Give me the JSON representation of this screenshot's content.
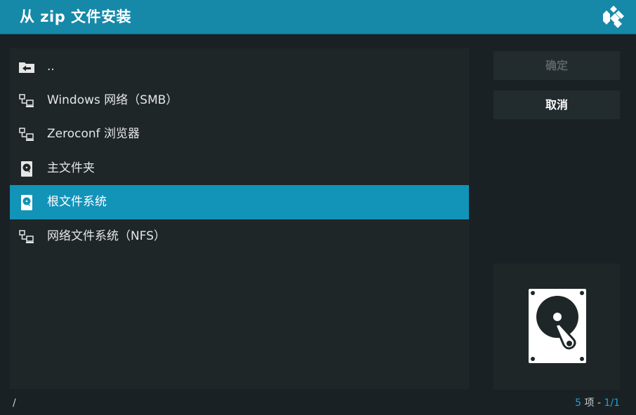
{
  "header": {
    "title": "从 zip 文件安装"
  },
  "list": {
    "items": [
      {
        "label": "..",
        "icon": "folder-back-icon"
      },
      {
        "label": "Windows 网络（SMB）",
        "icon": "network-icon"
      },
      {
        "label": "Zeroconf 浏览器",
        "icon": "network-icon"
      },
      {
        "label": "主文件夹",
        "icon": "harddisk-icon"
      },
      {
        "label": "根文件系统",
        "icon": "harddisk-icon",
        "selected": true
      },
      {
        "label": "网络文件系统（NFS）",
        "icon": "network-icon"
      }
    ]
  },
  "buttons": {
    "ok_label": "确定",
    "cancel_label": "取消"
  },
  "preview": {
    "icon": "harddisk-icon"
  },
  "footer": {
    "path": "/",
    "count_value": "5",
    "count_unit": " 项 - ",
    "page": "1/1"
  },
  "colors": {
    "header_bg": "#1689a8",
    "selected_bg": "#1293b8",
    "accent_text": "#1aa3d4",
    "panel_bg": "#1e2628"
  }
}
